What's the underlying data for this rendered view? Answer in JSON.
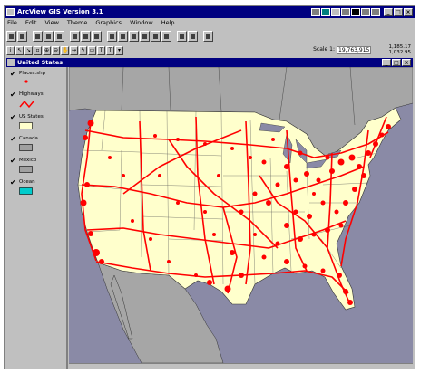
{
  "window": {
    "title": "ArcView GIS Version 3.1"
  },
  "menu": [
    "File",
    "Edit",
    "View",
    "Theme",
    "Graphics",
    "Window",
    "Help"
  ],
  "scale": {
    "label": "Scale 1:",
    "value": "19,763,915"
  },
  "coords": {
    "x": "1,185.17",
    "y": "1,032.95"
  },
  "view": {
    "title": "United States"
  },
  "toc": [
    {
      "name": "Places.shp",
      "symbol": "point",
      "color": "#ff0000"
    },
    {
      "name": "Highways",
      "symbol": "line",
      "color": "#ff0000"
    },
    {
      "name": "US States",
      "symbol": "fill",
      "color": "#ffffcc"
    },
    {
      "name": "Canada",
      "symbol": "fill",
      "color": "#a0a0a0"
    },
    {
      "name": "Mexico",
      "symbol": "fill",
      "color": "#a0a0a0"
    },
    {
      "name": "Ocean",
      "symbol": "fill",
      "color": "#00cccc"
    }
  ],
  "colors": {
    "ocean": "#8a8aa6",
    "land_other": "#a6a6a6",
    "states": "#ffffcc",
    "features": "#ff0000",
    "title_bar": "#000080"
  }
}
